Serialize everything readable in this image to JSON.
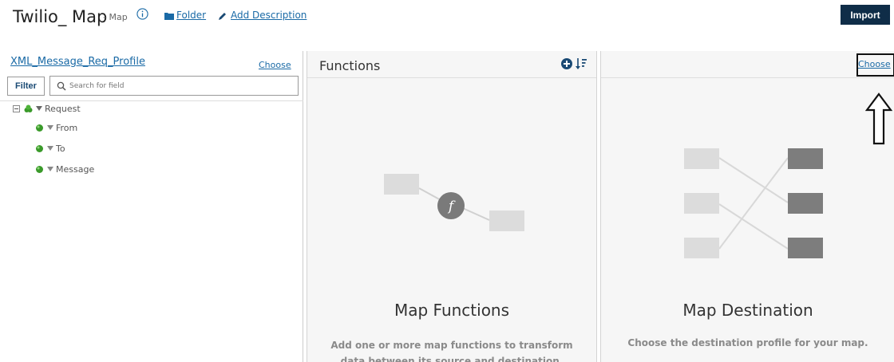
{
  "header": {
    "title": "Twilio_ Map",
    "subtitle": "- Map",
    "folder_label": "Folder",
    "add_description_label": "Add Description",
    "import_label": "Import"
  },
  "source": {
    "profile_name": "XML_Message_Req_Profile",
    "choose_label": "Choose",
    "filter_label": "Filter",
    "search_placeholder": "Search for field",
    "tree": [
      {
        "label": "Request",
        "level": 0
      },
      {
        "label": "From",
        "level": 1
      },
      {
        "label": "To",
        "level": 1
      },
      {
        "label": "Message",
        "level": 1
      }
    ]
  },
  "functions": {
    "header_title": "Functions",
    "empty_title": "Map Functions",
    "empty_desc_line1": "Add one or more map functions to transform",
    "empty_desc_line2": "data between its source and destination."
  },
  "destination": {
    "choose_label": "Choose",
    "empty_title": "Map Destination",
    "empty_desc": "Choose the destination profile for your map."
  },
  "colors": {
    "link": "#1a6aa6",
    "import_bg": "#0f2d48",
    "panel_bg": "#f6f6f6",
    "node_green": "#3a9a2a"
  },
  "icons": [
    "info-icon",
    "folder-icon",
    "pencil-icon",
    "search-icon",
    "collapse-icon",
    "node-icon",
    "caret-down-icon",
    "add-icon",
    "sort-icon",
    "arrow-up-icon"
  ]
}
